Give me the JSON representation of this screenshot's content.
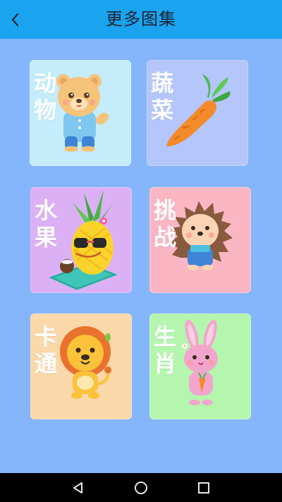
{
  "header": {
    "title": "更多图集",
    "back_icon": "chevron-left-icon"
  },
  "colors": {
    "background": "#85b6fb",
    "header": "#1aa3ef",
    "title_text": "#1d2433",
    "navbar": "#000000"
  },
  "gallery": [
    {
      "label": "动物",
      "bg": "#c4ecfa",
      "icon": "bear-icon"
    },
    {
      "label": "蔬菜",
      "bg": "#b4c6fb",
      "icon": "carrot-icon"
    },
    {
      "label": "水果",
      "bg": "#dcb0f5",
      "icon": "pineapple-icon"
    },
    {
      "label": "挑战",
      "bg": "#fbb6c3",
      "icon": "hedgehog-icon"
    },
    {
      "label": "卡通",
      "bg": "#fbd8aa",
      "icon": "lion-icon"
    },
    {
      "label": "生肖",
      "bg": "#b4f6ae",
      "icon": "rabbit-icon"
    }
  ],
  "system_nav": {
    "back": "nav-back-icon",
    "home": "nav-home-icon",
    "recents": "nav-recents-icon"
  }
}
